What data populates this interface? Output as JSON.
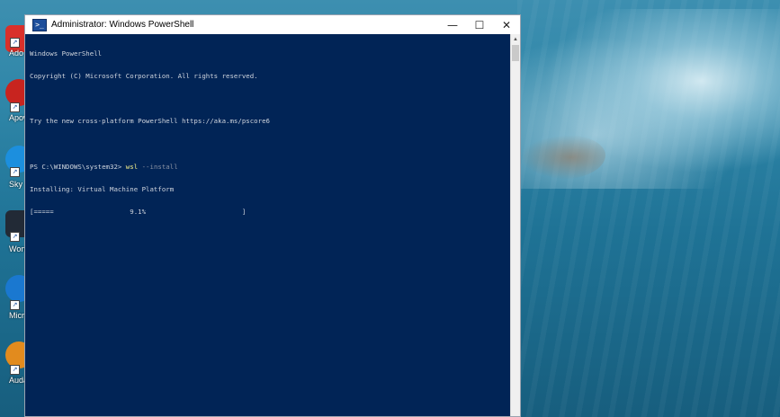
{
  "window": {
    "title": "Administrator: Windows PowerShell",
    "minimize_symbol": "—",
    "maximize_symbol": "☐",
    "close_symbol": "✕"
  },
  "console": {
    "lines": [
      "Windows PowerShell",
      "Copyright (C) Microsoft Corporation. All rights reserved.",
      "",
      "Try the new cross-platform PowerShell https://aka.ms/pscore6",
      ""
    ],
    "prompt": "PS C:\\WINDOWS\\system32> ",
    "command": "wsl",
    "command_args": " --install",
    "status_line": "Installing: Virtual Machine Platform",
    "progress": {
      "bar_text": "[=====                   9.1%                        ]",
      "percent": "9.1%"
    }
  },
  "desktop_icons": [
    {
      "label": "Ado Acro",
      "color": "#d9302a"
    },
    {
      "label": "Apow",
      "color": "#c8241f"
    },
    {
      "label": "Sky",
      "color": "#1c8fde"
    },
    {
      "label": "Wonde Film",
      "color": "#222a36"
    },
    {
      "label": "Micro Ed",
      "color": "#1a78d0"
    },
    {
      "label": "Auda",
      "color": "#e28b1e"
    }
  ],
  "colors": {
    "console_bg": "#012456",
    "command_highlight": "#f5f08a"
  }
}
